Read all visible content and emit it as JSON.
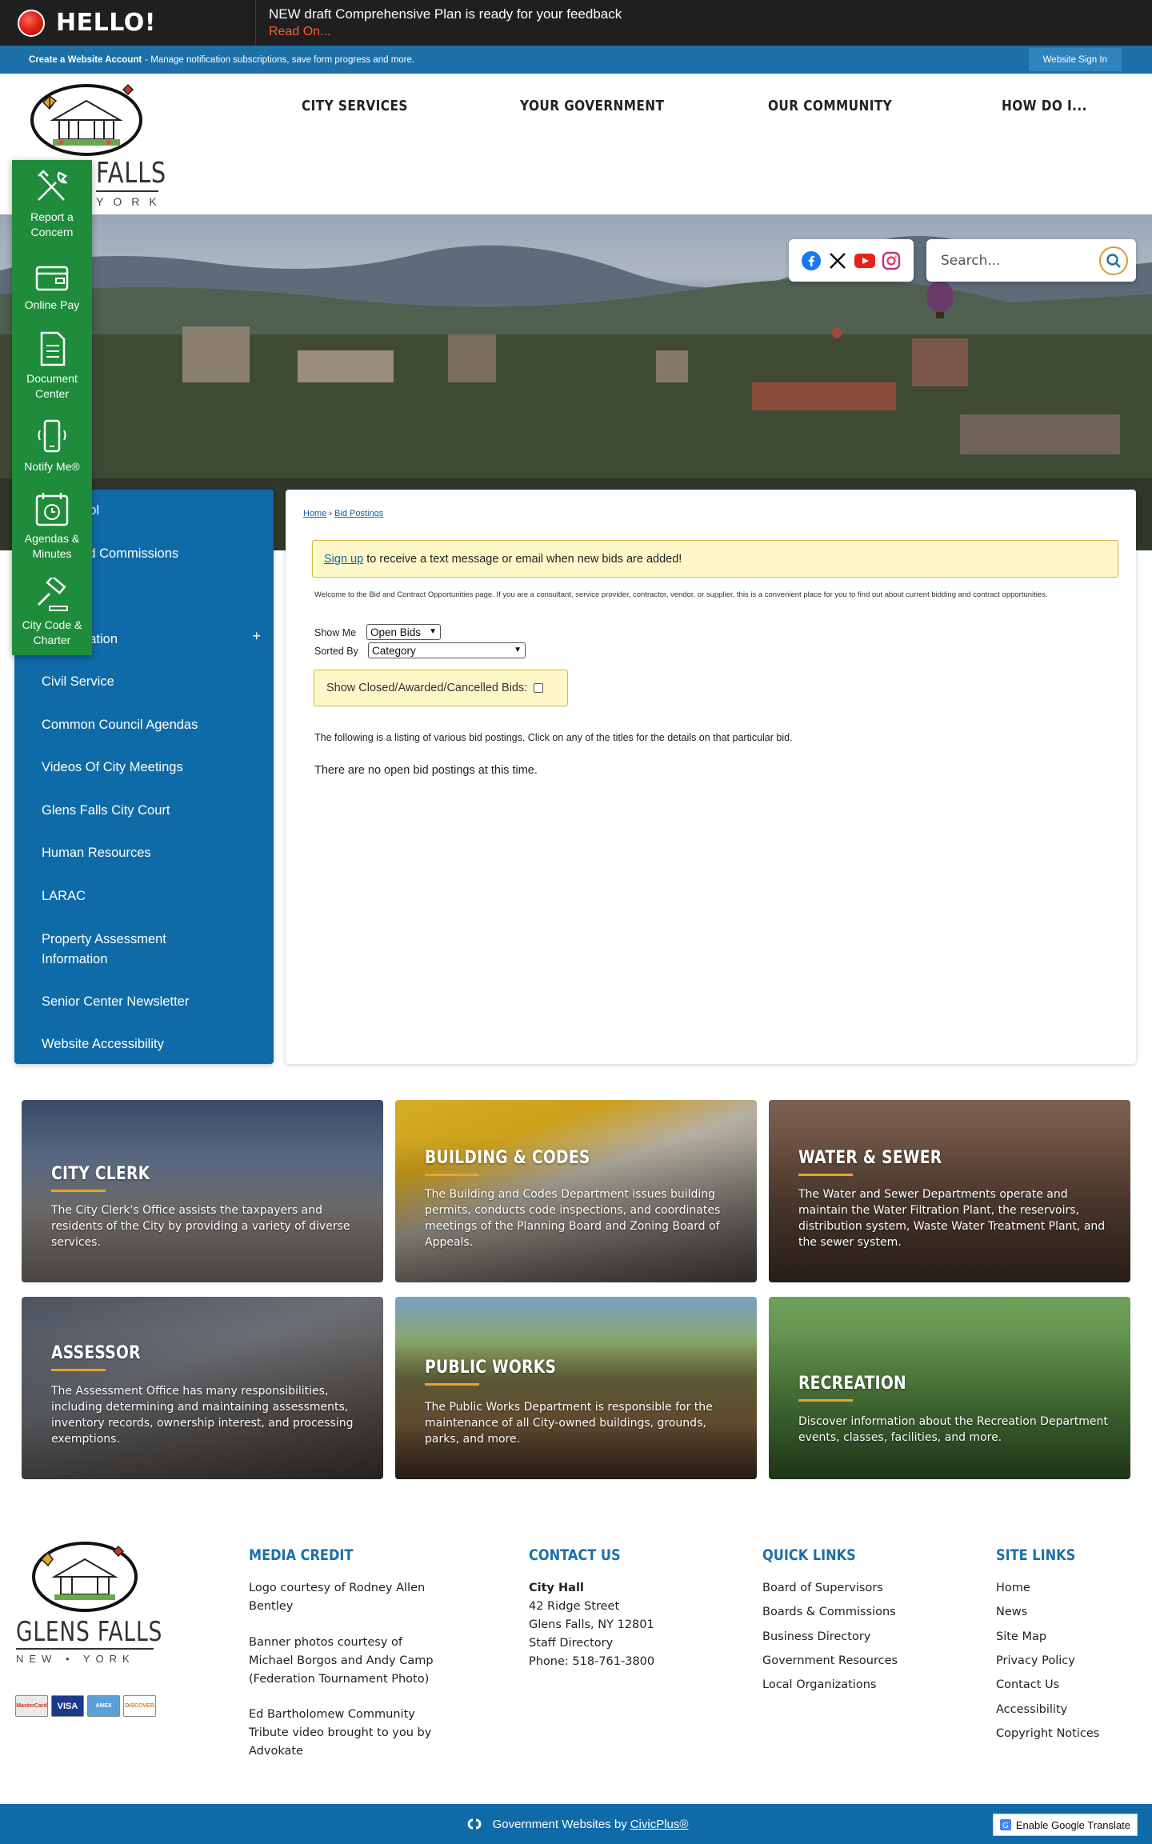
{
  "alert": {
    "hello": "HELLO!",
    "message": "NEW draft Comprehensive Plan is ready for your feedback",
    "link": "Read On..."
  },
  "account_bar": {
    "create_label": "Create a Website Account",
    "create_text": " - Manage notification subscriptions, save form progress and more.",
    "sign_in": "Website Sign In"
  },
  "logo": {
    "falls": "FALLS",
    "york": "YORK"
  },
  "nav": [
    "CITY SERVICES",
    "YOUR GOVERNMENT",
    "OUR COMMUNITY",
    "HOW DO I..."
  ],
  "search": {
    "placeholder": "Search..."
  },
  "quick_links": [
    {
      "label": "Report a Concern",
      "icon": "tools-icon"
    },
    {
      "label": "Online Pay",
      "icon": "wallet-icon"
    },
    {
      "label": "Document Center",
      "icon": "document-icon"
    },
    {
      "label": "Notify Me®",
      "icon": "phone-notify-icon"
    },
    {
      "label": "Agendas & Minutes",
      "icon": "calendar-clock-icon"
    },
    {
      "label": "City Code & Charter",
      "icon": "gavel-icon"
    }
  ],
  "sidebar": {
    "items": [
      {
        "label": "ntrol"
      },
      {
        "label": "and Commissions"
      },
      {
        "label": "rmation",
        "expand": "+"
      },
      {
        "label": "Civil Service"
      },
      {
        "label": "Common Council Agendas"
      },
      {
        "label": "Videos Of City Meetings"
      },
      {
        "label": "Glens Falls City Court"
      },
      {
        "label": "Human Resources"
      },
      {
        "label": "LARAC"
      },
      {
        "label": "Property Assessment Information"
      },
      {
        "label": "Senior Center Newsletter"
      },
      {
        "label": "Website Accessibility"
      }
    ]
  },
  "content": {
    "breadcrumb": {
      "home": "Home",
      "sep": " › ",
      "current": "Bid Postings"
    },
    "notice_link": "Sign up",
    "notice_text": "to receive a text message or email when new bids are added!",
    "welcome": "Welcome to the Bid and Contract Opportunities page. If you are a consultant, service provider, contractor, vendor, or supplier, this is a convenient place for you to find out about current bidding and contract opportunities.",
    "show_me_label": "Show Me",
    "show_me_value": "Open Bids",
    "sorted_by_label": "Sorted By",
    "sorted_by_value": "Category",
    "closed_label": "Show Closed/Awarded/Cancelled Bids:",
    "listing_text": "The following is a listing of various bid postings. Click on any of the titles for the details on that particular bid.",
    "no_bids": "There are no open bid postings at this time."
  },
  "tiles": [
    {
      "title": "CITY CLERK",
      "desc": "The City Clerk's Office assists the taxpayers and residents of the City by providing a variety of diverse services."
    },
    {
      "title": "BUILDING & CODES",
      "desc": "The Building and Codes Department issues building permits, conducts code inspections, and coordinates meetings of the Planning Board and Zoning Board of Appeals."
    },
    {
      "title": "WATER & SEWER",
      "desc": "The Water and Sewer Departments operate and maintain the Water Filtration Plant, the reservoirs, distribution system, Waste Water Treatment Plant, and the sewer system."
    },
    {
      "title": "ASSESSOR",
      "desc": "The Assessment Office has many responsibilities, including determining and maintaining assessments, inventory records, ownership interest, and processing exemptions."
    },
    {
      "title": "PUBLIC WORKS",
      "desc": "The Public Works Department is responsible for the maintenance of all City-owned buildings, grounds, parks, and more."
    },
    {
      "title": "RECREATION",
      "desc": "Discover information about the Recreation Department events, classes, facilities, and more."
    }
  ],
  "footer": {
    "logo_main": "GLENS FALLS",
    "logo_sub": "NEW • YORK",
    "cards": [
      "MasterCard",
      "VISA",
      "AMEX",
      "DISCOVER"
    ],
    "media_credit": {
      "heading": "MEDIA CREDIT",
      "p1": "Logo courtesy of Rodney Allen Bentley",
      "p2": "Banner photos courtesy of Michael Borgos and Andy Camp (Federation Tournament Photo)",
      "p3": "Ed Bartholomew Community Tribute video brought to you by Advokate"
    },
    "contact": {
      "heading": "CONTACT US",
      "name": "City Hall",
      "lines": [
        "42 Ridge Street",
        "Glens Falls, NY 12801",
        "Staff Directory",
        "Phone: 518-761-3800"
      ]
    },
    "quick_links": {
      "heading": "QUICK LINKS",
      "items": [
        "Board of Supervisors",
        "Boards & Commissions",
        "Business Directory",
        "Government Resources",
        "Local Organizations"
      ]
    },
    "site_links": {
      "heading": "SITE LINKS",
      "items": [
        "Home",
        "News",
        "Site Map",
        "Privacy Policy",
        "Contact Us",
        "Accessibility",
        "Copyright Notices"
      ]
    }
  },
  "bottom": {
    "text": "Government Websites by",
    "link": "CivicPlus®",
    "translate": "Enable Google Translate"
  }
}
